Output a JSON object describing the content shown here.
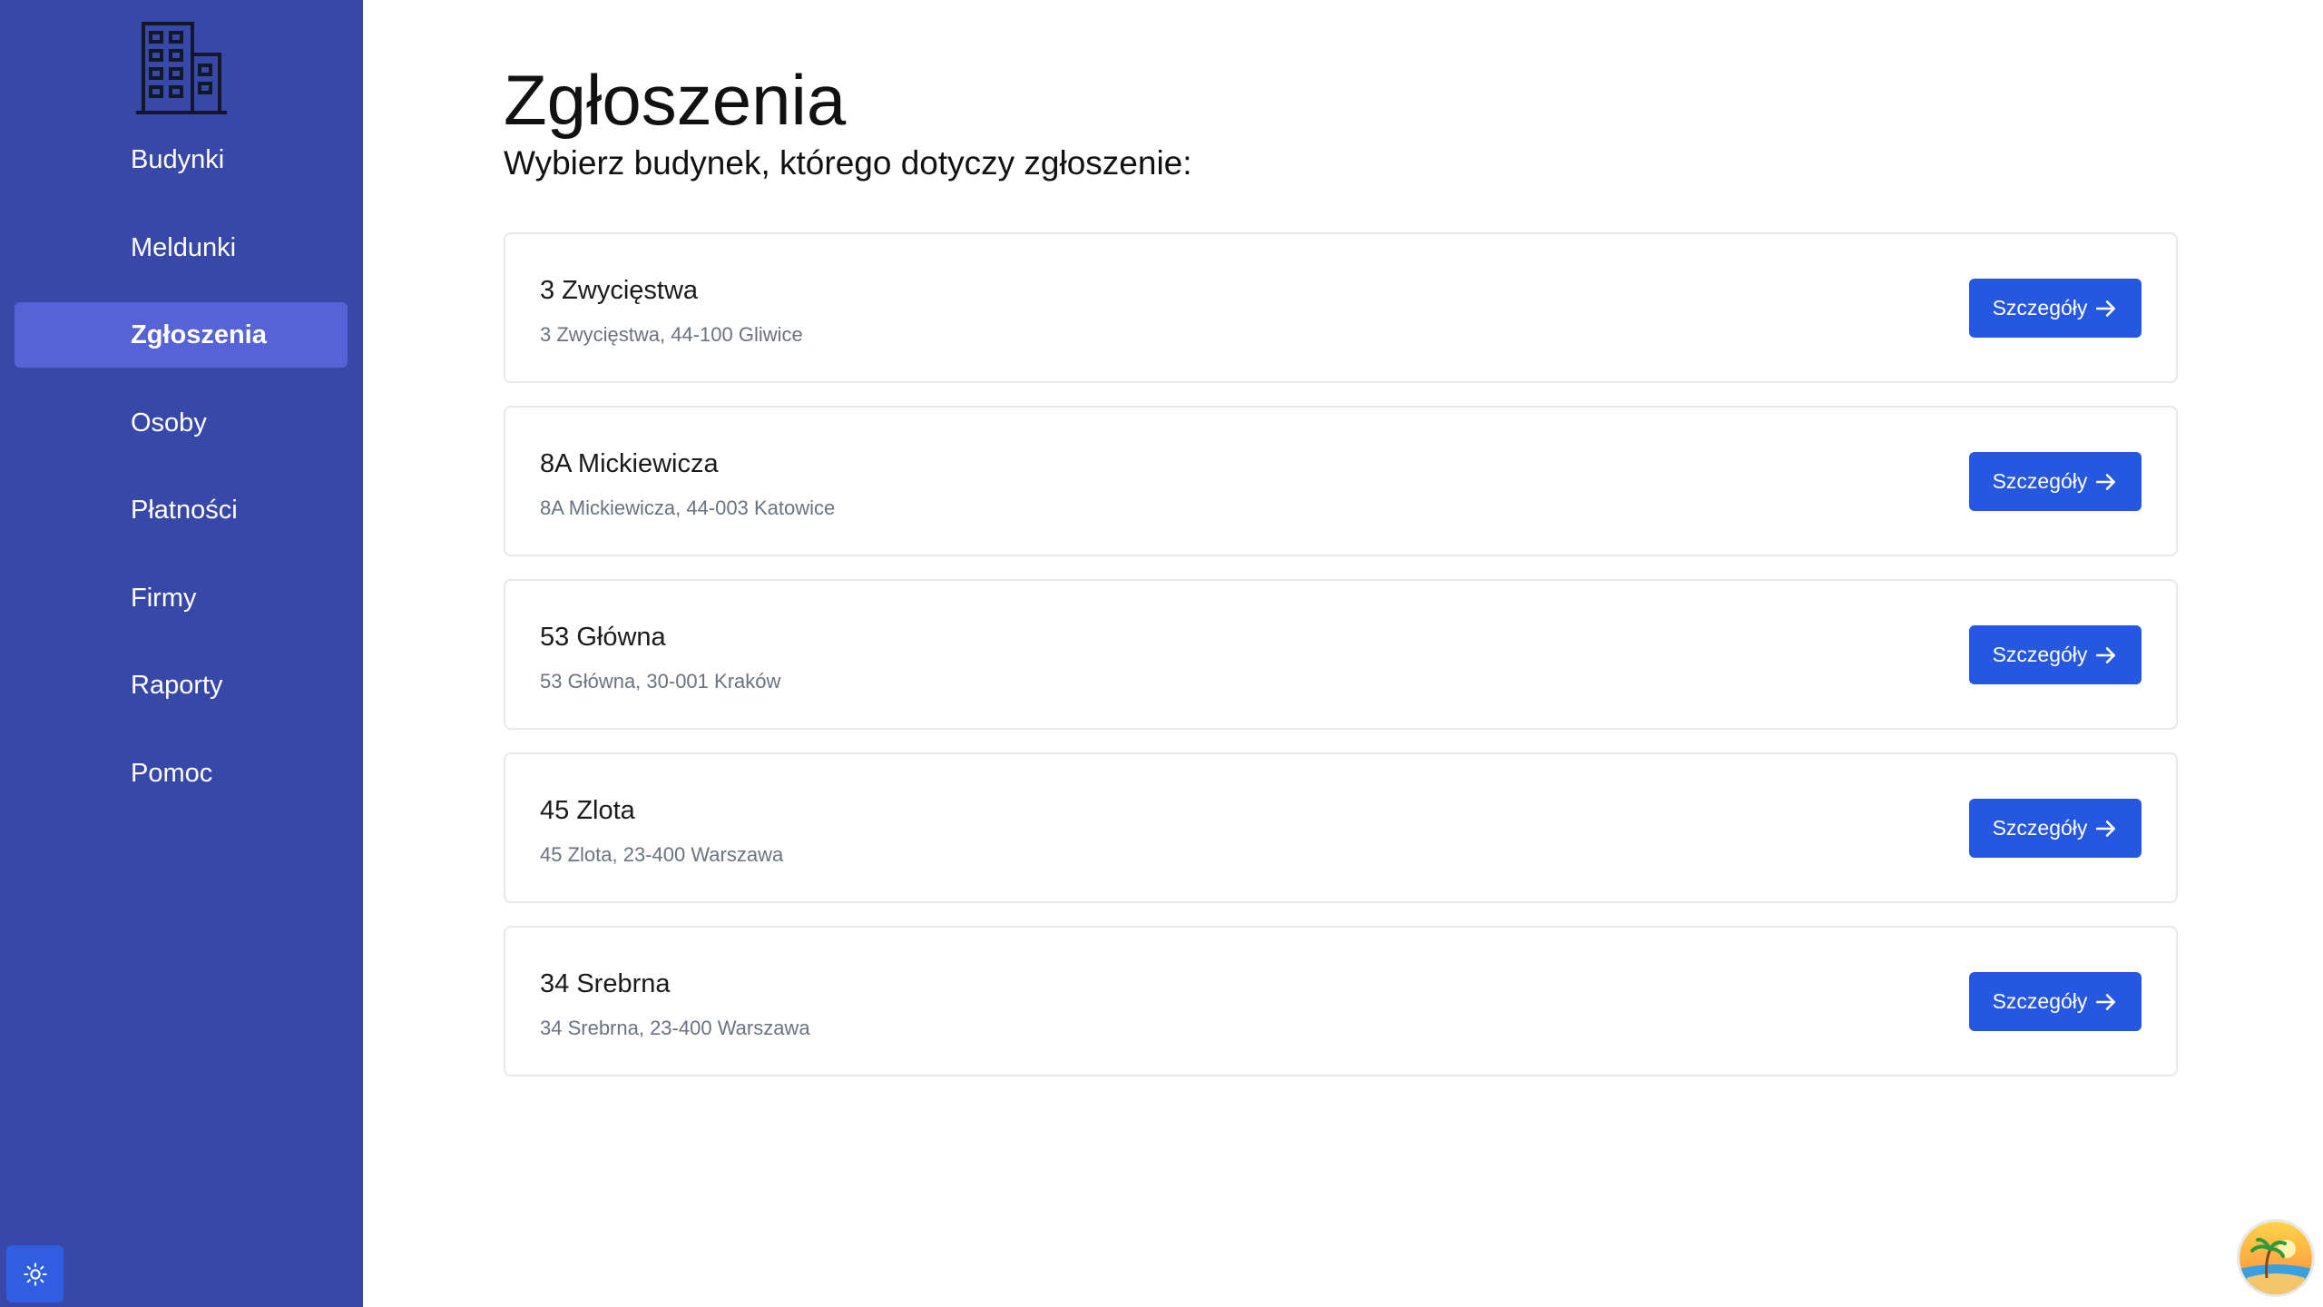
{
  "sidebar": {
    "items": [
      {
        "label": "Budynki",
        "active": false
      },
      {
        "label": "Meldunki",
        "active": false
      },
      {
        "label": "Zgłoszenia",
        "active": true
      },
      {
        "label": "Osoby",
        "active": false
      },
      {
        "label": "Płatności",
        "active": false
      },
      {
        "label": "Firmy",
        "active": false
      },
      {
        "label": "Raporty",
        "active": false
      },
      {
        "label": "Pomoc",
        "active": false
      }
    ]
  },
  "main": {
    "title": "Zgłoszenia",
    "subtitle": "Wybierz budynek, którego dotyczy zgłoszenie:",
    "buildings": [
      {
        "name": "3 Zwycięstwa",
        "address": "3 Zwycięstwa, 44-100 Gliwice",
        "button_label": "Szczegóły"
      },
      {
        "name": "8A Mickiewicza",
        "address": "8A Mickiewicza, 44-003 Katowice",
        "button_label": "Szczegóły"
      },
      {
        "name": "53 Główna",
        "address": "53 Główna, 30-001 Kraków",
        "button_label": "Szczegóły"
      },
      {
        "name": "45 Zlota",
        "address": "45 Zlota, 23-400 Warszawa",
        "button_label": "Szczegóły"
      },
      {
        "name": "34 Srebrna",
        "address": "34 Srebrna, 23-400 Warszawa",
        "button_label": "Szczegóły"
      }
    ]
  },
  "icons": {
    "logo": "building-icon",
    "theme_toggle": "sun-icon",
    "button_arrow": "arrow-right-icon",
    "avatar": "beach-avatar"
  },
  "colors": {
    "sidebar_bg": "#3848a8",
    "sidebar_active_bg": "#5563d6",
    "button_bg": "#2557e0",
    "card_border": "#e7e8ec",
    "address_text": "#6b7280"
  }
}
